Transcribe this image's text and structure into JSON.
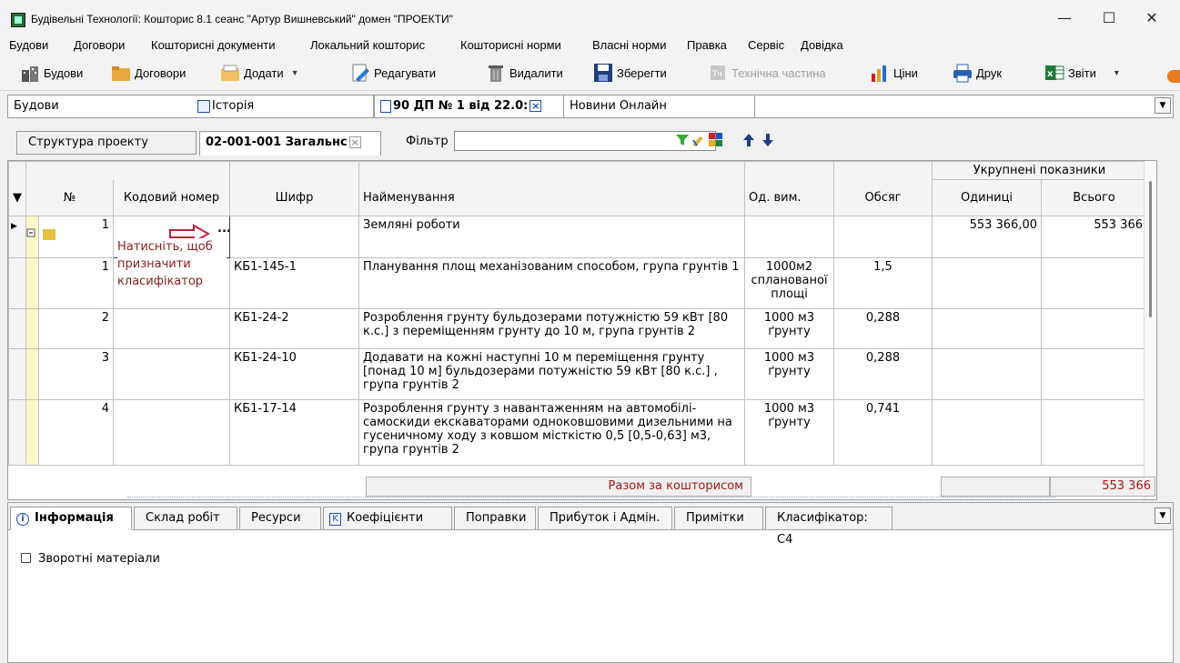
{
  "window": {
    "title": "Будівельні Технології: Кошторис 8.1    сеанс \"Артур Вишневський\"  домен \"ПРОЕКТИ\"",
    "minimize": "—",
    "maximize": "☐",
    "close": "✕"
  },
  "menu": [
    "Будови",
    "Договори",
    "Кошторисні документи",
    "Локальний кошторис",
    "Кошторисні норми",
    "Власні норми",
    "Правка",
    "Сервіс",
    "Довідка"
  ],
  "toolbar": {
    "buildings": "Будови",
    "contracts": "Договори",
    "add": "Додати",
    "edit": "Редагувати",
    "delete": "Видалити",
    "save": "Зберегти",
    "technical": "Технічна частина",
    "prices": "Ціни",
    "print": "Друк",
    "reports": "Звіти"
  },
  "doc_tabs": {
    "buildings": "Будови",
    "history": "Історія",
    "document": "90 ДП № 1 від 22.0:",
    "news": "Новини Онлайн"
  },
  "sub_tabs": {
    "structure": "Структура проекту",
    "active": "02-001-001 Загальнс",
    "filter_label": "Фільтр",
    "filter_value": ""
  },
  "grid": {
    "group_header": "Укрупнені показники",
    "headers": {
      "num": "№",
      "code": "Кодовий номер",
      "cipher": "Шифр",
      "name": "Найменування",
      "unit": "Од. вим.",
      "volume": "Обсяг",
      "units": "Одиниці",
      "total": "Всього"
    },
    "section": {
      "num": "1",
      "name": "Земляні роботи",
      "units": "553 366,00",
      "total": "553 366",
      "hint": "Натисніть, щоб призначити класифікатор"
    },
    "rows": [
      {
        "num": "1",
        "cipher": "КБ1-145-1",
        "name": "Планування площ механізованим способом, група грунтів 1",
        "unit": "1000м2 спланованої площі",
        "volume": "1,5"
      },
      {
        "num": "2",
        "cipher": "КБ1-24-2",
        "name": "Розроблення грунту бульдозерами потужністю 59 кВт [80 к.с.] з переміщенням грунту до 10 м, група грунтів 2",
        "unit": "1000 м3 ґрунту",
        "volume": "0,288"
      },
      {
        "num": "3",
        "cipher": "КБ1-24-10",
        "name": "Додавати на кожні наступні 10 м переміщення грунту [понад 10 м] бульдозерами потужністю 59 кВт [80 к.с.] , група грунтів 2",
        "unit": "1000 м3 ґрунту",
        "volume": "0,288"
      },
      {
        "num": "4",
        "cipher": "КБ1-17-14",
        "name": "Розроблення грунту з навантаженням на автомобілі-самоскиди екскаваторами одноковшовими дизельними на гусеничному ходу з ковшом місткістю 0,5 [0,5-0,63] м3, група грунтів 2",
        "unit": "1000 м3 ґрунту",
        "volume": "0,741"
      }
    ],
    "total_label": "Разом за кошторисом",
    "total_value": "553 366"
  },
  "bottom_tabs": [
    "Інформація",
    "Склад робіт",
    "Ресурси",
    "Коефіцієнти",
    "Поправки",
    "Прибуток і Адмін.",
    "Примітки",
    "Класифікатор: С4"
  ],
  "info": {
    "return_materials": "Зворотні матеріали"
  }
}
